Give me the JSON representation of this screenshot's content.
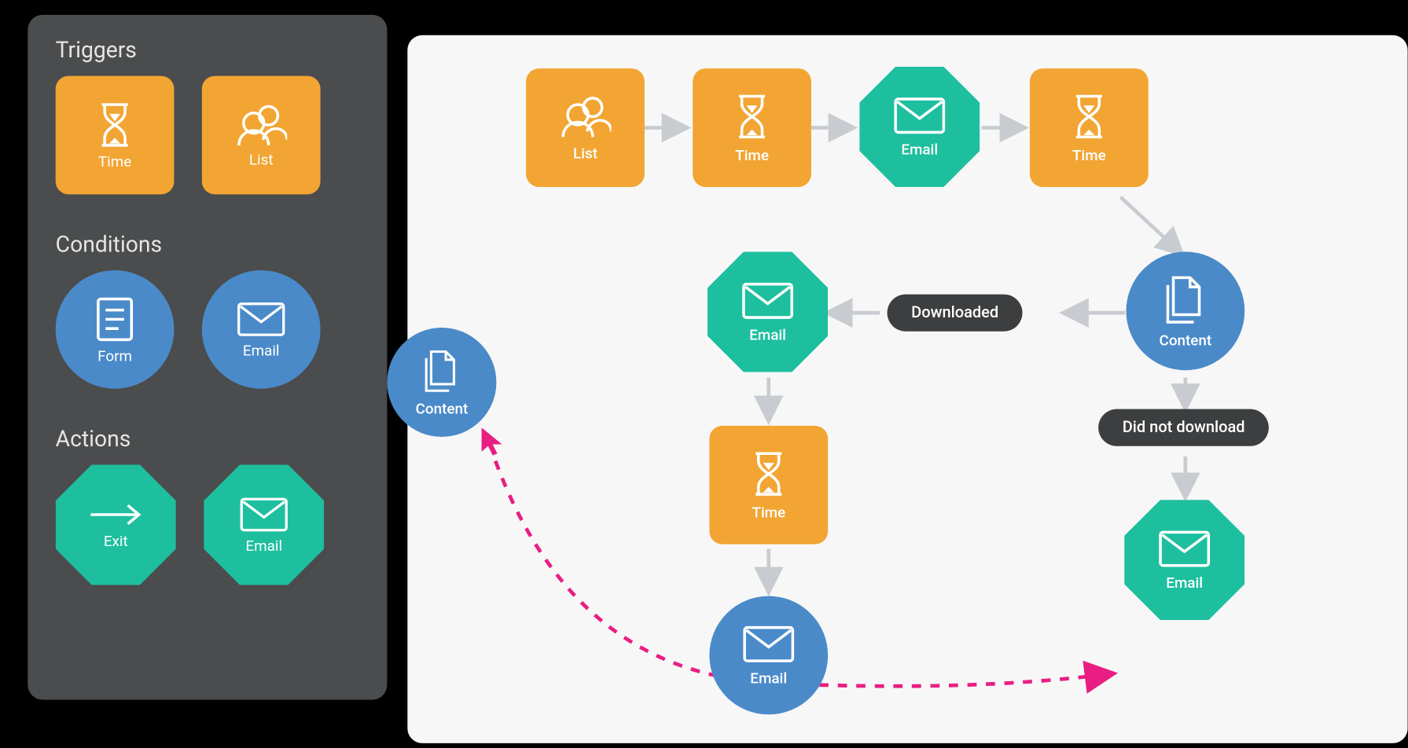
{
  "palette": {
    "triggers": {
      "heading": "Triggers",
      "items": [
        {
          "label": "Time",
          "icon": "hourglass"
        },
        {
          "label": "List",
          "icon": "users"
        }
      ]
    },
    "conditions": {
      "heading": "Conditions",
      "items": [
        {
          "label": "Form",
          "icon": "form"
        },
        {
          "label": "Email",
          "icon": "envelope"
        }
      ]
    },
    "actions": {
      "heading": "Actions",
      "items": [
        {
          "label": "Exit",
          "icon": "arrow-right"
        },
        {
          "label": "Email",
          "icon": "envelope"
        }
      ]
    }
  },
  "dragging": {
    "label": "Content",
    "icon": "document-copy"
  },
  "canvas": {
    "nodes": {
      "list": {
        "label": "List",
        "icon": "users"
      },
      "time1": {
        "label": "Time",
        "icon": "hourglass"
      },
      "email1": {
        "label": "Email",
        "icon": "envelope"
      },
      "time2": {
        "label": "Time",
        "icon": "hourglass"
      },
      "content": {
        "label": "Content",
        "icon": "document-copy"
      },
      "email2": {
        "label": "Email",
        "icon": "envelope"
      },
      "time3": {
        "label": "Time",
        "icon": "hourglass"
      },
      "email3": {
        "label": "Email",
        "icon": "envelope"
      },
      "email4": {
        "label": "Email",
        "icon": "envelope"
      }
    },
    "edges": {
      "downloaded": "Downloaded",
      "didNotDownload": "Did not download"
    }
  }
}
